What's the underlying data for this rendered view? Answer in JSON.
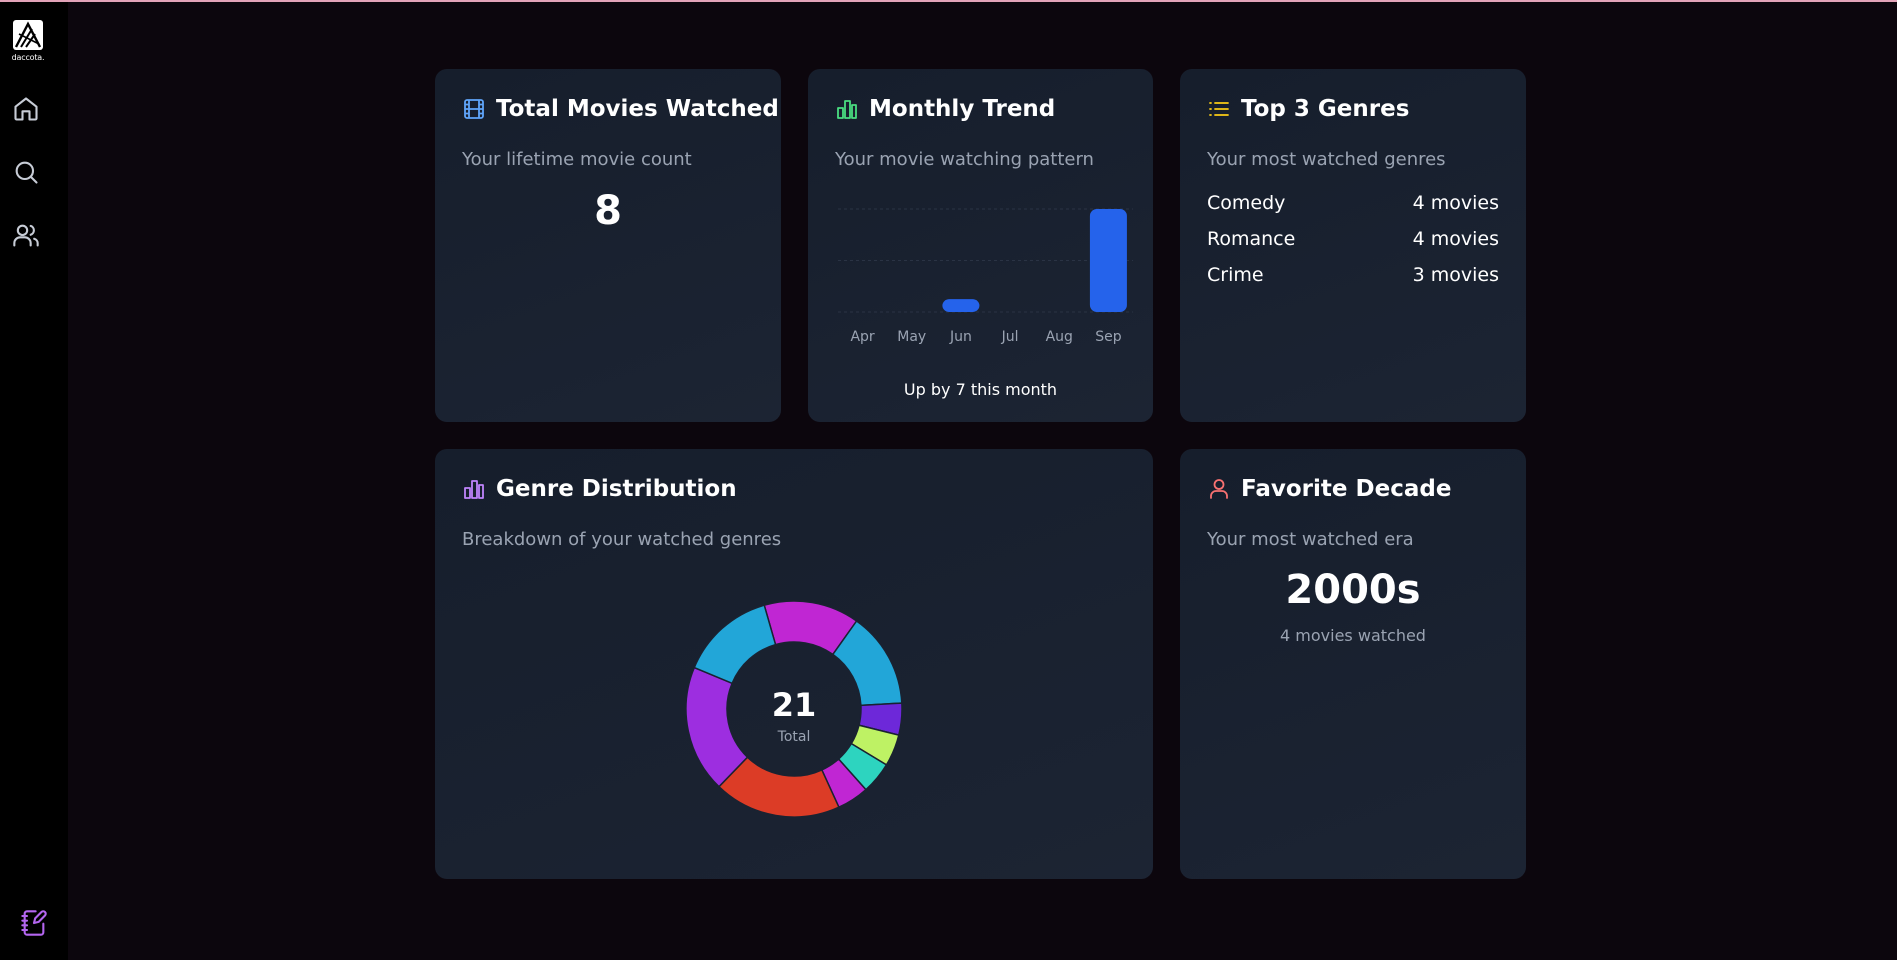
{
  "sidebar": {
    "logo_text": "daccota.",
    "items": [
      {
        "name": "home",
        "icon": "home-icon"
      },
      {
        "name": "search",
        "icon": "search-icon"
      },
      {
        "name": "users",
        "icon": "users-icon"
      }
    ],
    "bottom_icon": "notebook-pen-icon"
  },
  "cards": {
    "total_movies": {
      "title": "Total Movies Watched",
      "subtitle": "Your lifetime movie count",
      "value": "8",
      "icon": "film-icon",
      "icon_color": "#60a5fa"
    },
    "monthly_trend": {
      "title": "Monthly Trend",
      "subtitle": "Your movie watching pattern",
      "note": "Up by 7 this month",
      "icon": "bar-chart-icon",
      "icon_color": "#4ade80"
    },
    "top_genres": {
      "title": "Top 3 Genres",
      "subtitle": "Your most watched genres",
      "icon": "list-icon",
      "icon_color": "#facc15",
      "rows": [
        {
          "genre": "Comedy",
          "count": "4 movies"
        },
        {
          "genre": "Romance",
          "count": "4 movies"
        },
        {
          "genre": "Crime",
          "count": "3 movies"
        }
      ]
    },
    "genre_distribution": {
      "title": "Genre Distribution",
      "subtitle": "Breakdown of your watched genres",
      "total_value": "21",
      "total_label": "Total",
      "icon": "bar-chart-icon",
      "icon_color": "#c084fc"
    },
    "favorite_decade": {
      "title": "Favorite Decade",
      "subtitle": "Your most watched era",
      "value": "2000s",
      "detail": "4 movies watched",
      "icon": "user-icon",
      "icon_color": "#f87171"
    }
  },
  "chart_data": [
    {
      "type": "bar",
      "categories": [
        "Apr",
        "May",
        "Jun",
        "Jul",
        "Aug",
        "Sep"
      ],
      "values": [
        0,
        0,
        1,
        0,
        0,
        8
      ],
      "ylim": [
        0,
        8
      ],
      "grid": true,
      "bar_color": "#2563eb"
    },
    {
      "type": "pie",
      "donut": true,
      "slices": [
        {
          "value": 3,
          "color": "#c026d3"
        },
        {
          "value": 3,
          "color": "#22a6d8"
        },
        {
          "value": 1,
          "color": "#6d28d9"
        },
        {
          "value": 1,
          "color": "#bef264"
        },
        {
          "value": 1,
          "color": "#2dd4bf"
        },
        {
          "value": 1,
          "color": "#c026d3"
        },
        {
          "value": 4,
          "color": "#dc3c26"
        },
        {
          "value": 4,
          "color": "#9d2ee0"
        },
        {
          "value": 3,
          "color": "#22a6d8"
        }
      ]
    }
  ]
}
